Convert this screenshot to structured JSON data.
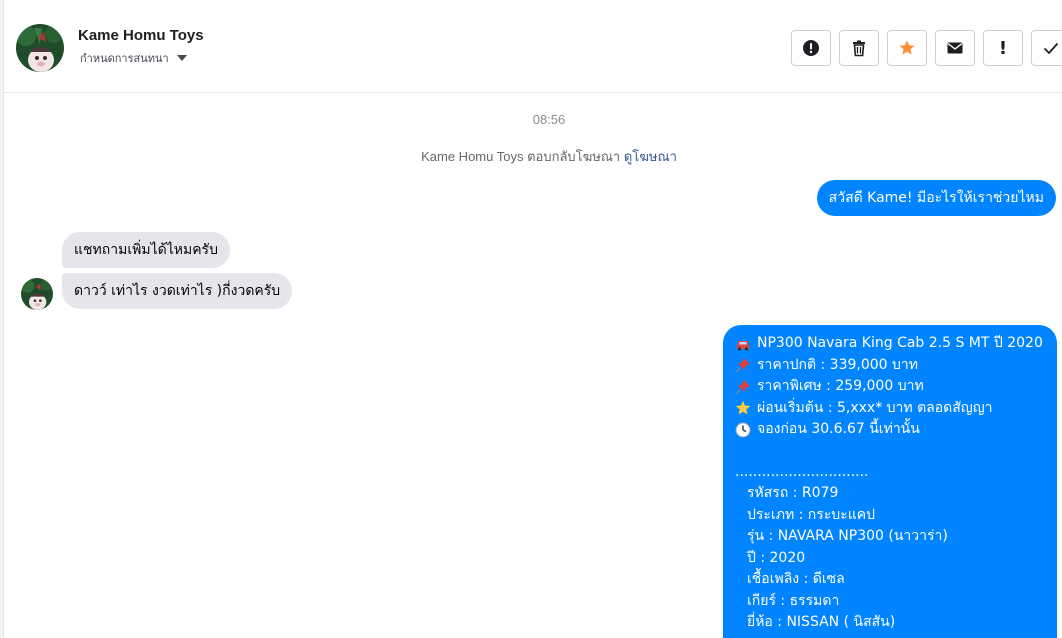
{
  "header": {
    "page_name": "Kame Homu Toys",
    "assign_label": "กำหนดการสนทนา"
  },
  "toolbar": {
    "icons": [
      "alert-circle-icon",
      "trash-icon",
      "star-icon",
      "envelope-icon",
      "exclamation-icon",
      "checkmark-icon"
    ],
    "exclamation_glyph": "!",
    "star_color": "#f7923a"
  },
  "conversation": {
    "timestamp": "08:56",
    "replied_prefix": "Kame Homu Toys ตอบกลับโฆษณา",
    "replied_link": "ดูโฆษณา",
    "messages": [
      {
        "direction": "out",
        "text": "สวัสดี Kame! มีอะไรให้เราช่วยไหม"
      },
      {
        "direction": "in",
        "text": "แชทถามเพิ่มได้ไหมครับ"
      },
      {
        "direction": "in",
        "text": "ดาวว์ เท่าไร งวดเท่าไร )กี่งวดครับ"
      }
    ],
    "offer": {
      "lines": [
        {
          "icon": "car-icon",
          "text": "NP300 Navara King Cab 2.5 S MT ปี 2020"
        },
        {
          "icon": "pushpin-icon",
          "text": "ราคาปกติ : 339,000 บาท"
        },
        {
          "icon": "pushpin-icon",
          "text": "ราคาพิเศษ : 259,000 บาท"
        },
        {
          "icon": "star-icon",
          "text": "ผ่อนเริ่มต้น : 5,xxx* บาท ตลอดสัญญา"
        },
        {
          "icon": "clock-icon",
          "text": "จองก่อน 30.6.67 นี้เท่านั้น"
        }
      ],
      "separator": "..............................",
      "details": [
        "รหัสรถ : R079",
        "ประเภท : กระบะแคป",
        "รุ่น : NAVARA NP300 (นาวาร่า)",
        "ปี : 2020",
        "เชื้อเพลิง : ดีเซล",
        "เกียร์ : ธรรมดา",
        "ยี่ห้อ : NISSAN ( นิสสัน)"
      ]
    }
  },
  "colors": {
    "outgoing_bubble": "#0084ff",
    "incoming_bubble": "#e4e6eb",
    "link": "#385898"
  }
}
